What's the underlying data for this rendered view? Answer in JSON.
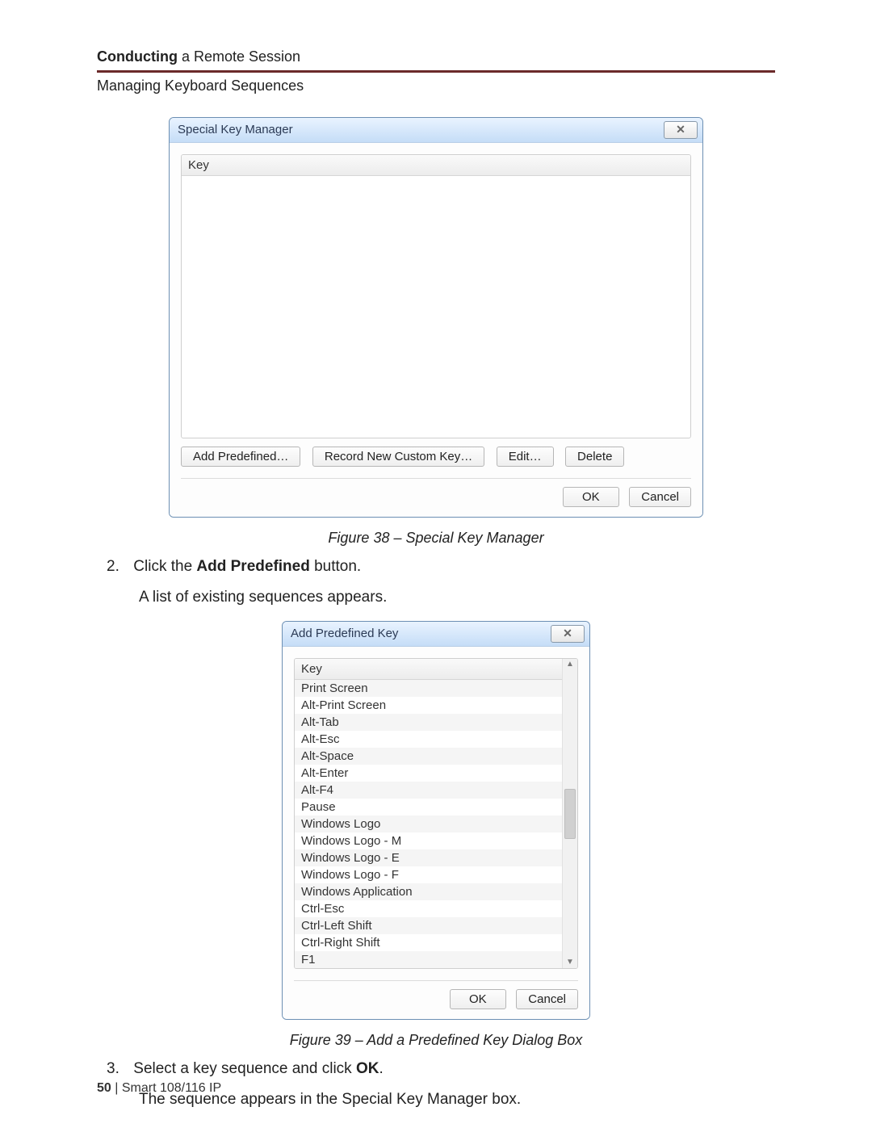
{
  "header": {
    "chapter_bold": "Conducting",
    "chapter_rest": " a Remote Session",
    "subsection": "Managing Keyboard Sequences"
  },
  "dialog1": {
    "title": "Special Key Manager",
    "column_header": "Key",
    "buttons": {
      "add_predefined": "Add Predefined…",
      "record_new": "Record New Custom Key…",
      "edit": "Edit…",
      "delete": "Delete",
      "ok": "OK",
      "cancel": "Cancel"
    }
  },
  "fig38_caption": "Figure 38 – Special Key Manager",
  "step2": {
    "num": "2.",
    "text_pre": "Click the ",
    "text_bold": "Add Predefined",
    "text_post": " button.",
    "result": "A list of existing sequences appears."
  },
  "dialog2": {
    "title": "Add Predefined Key",
    "column_header": "Key",
    "items": [
      "Print Screen",
      "Alt-Print Screen",
      "Alt-Tab",
      "Alt-Esc",
      "Alt-Space",
      "Alt-Enter",
      "Alt-F4",
      "Pause",
      "Windows Logo",
      "Windows Logo - M",
      "Windows Logo - E",
      "Windows Logo - F",
      "Windows Application",
      "Ctrl-Esc",
      "Ctrl-Left Shift",
      "Ctrl-Right Shift",
      "F1"
    ],
    "buttons": {
      "ok": "OK",
      "cancel": "Cancel"
    }
  },
  "fig39_caption": "Figure 39 – Add a Predefined Key Dialog Box",
  "step3": {
    "num": "3.",
    "text_pre": "Select a key sequence and click ",
    "text_bold": "OK",
    "text_post": ".",
    "result": "The sequence appears in the Special Key Manager box."
  },
  "footer": {
    "page_num": "50",
    "sep": "  |  ",
    "product": "Smart 108/116 IP"
  }
}
